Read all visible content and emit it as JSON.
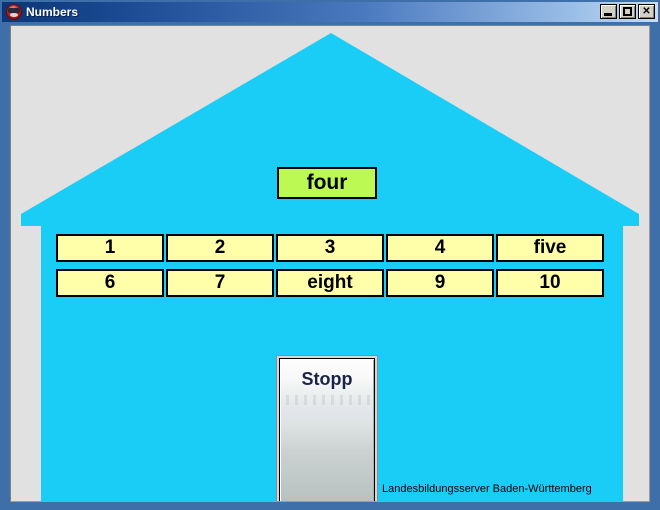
{
  "window": {
    "title": "Numbers",
    "icon": "app-emblem-icon",
    "controls": [
      {
        "name": "minimize",
        "glyph": "_"
      },
      {
        "name": "maximize",
        "glyph": "□"
      },
      {
        "name": "close",
        "glyph": "✕"
      }
    ]
  },
  "colors": {
    "house": "#1acdf7",
    "window_background": "#e1e1e1",
    "word_box": "#bdf953",
    "number_button": "#ffffaa",
    "title_gradient_start": "#0b3576",
    "title_gradient_end": "#c9dcf2",
    "stopp_text": "#1b2448"
  },
  "main": {
    "prompt_word": "four",
    "number_buttons": [
      {
        "label": "1",
        "row": 1,
        "col": 1
      },
      {
        "label": "2",
        "row": 1,
        "col": 2
      },
      {
        "label": "3",
        "row": 1,
        "col": 3
      },
      {
        "label": "4",
        "row": 1,
        "col": 4
      },
      {
        "label": "five",
        "row": 1,
        "col": 5
      },
      {
        "label": "6",
        "row": 2,
        "col": 1
      },
      {
        "label": "7",
        "row": 2,
        "col": 2
      },
      {
        "label": "eight",
        "row": 2,
        "col": 3
      },
      {
        "label": "9",
        "row": 2,
        "col": 4
      },
      {
        "label": "10",
        "row": 2,
        "col": 5
      }
    ],
    "stop_button": "Stopp",
    "credit": "Landesbildungsserver Baden-Württemberg"
  }
}
